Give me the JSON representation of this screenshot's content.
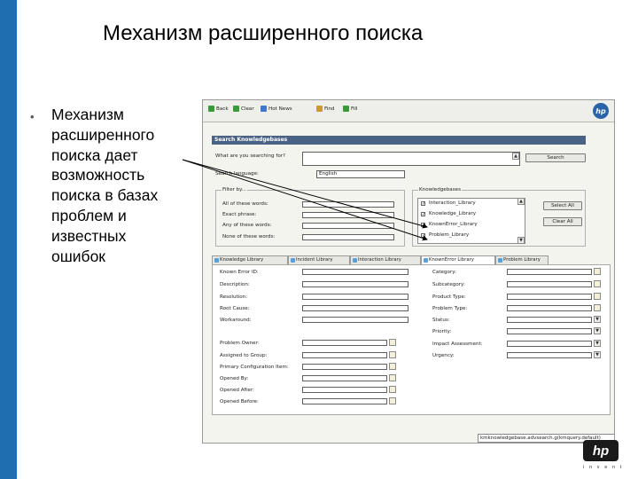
{
  "slide": {
    "title": "Механизм расширенного поиска",
    "bullet_lines": [
      "Механизм",
      "расширенного",
      "поиска дает",
      "возможность",
      "поиска в базах",
      "проблем и",
      "известных",
      "ошибок"
    ]
  },
  "toolbar": {
    "back": "Back",
    "clear": "Clear",
    "hot_news": "Hot News",
    "find": "Find",
    "fill": "Fill",
    "logo": "hp"
  },
  "search": {
    "header": "Search Knowledgebases",
    "what_label": "What are you searching for?",
    "lang_label": "Search language:",
    "lang_value": "English",
    "search_button": "Search"
  },
  "filter": {
    "title": "Filter by...",
    "rows": [
      "All of these words:",
      "Exact phrase:",
      "Any of these words:",
      "None of these words:"
    ]
  },
  "kb": {
    "title": "Knowledgebases",
    "items": [
      "Interaction_Library",
      "Knowledge_Library",
      "KnownError_Library",
      "Problem_Library"
    ],
    "select_all": "Select All",
    "clear_all": "Clear All"
  },
  "tabs": [
    "Knowledge Library",
    "Incident Library",
    "Interaction Library",
    "KnownError Library",
    "Problem Library"
  ],
  "known_error": {
    "left_top": [
      "Known Error ID:",
      "Description:",
      "Resolution:",
      "Root Cause:",
      "Workaround:"
    ],
    "left_bottom": [
      "Problem Owner:",
      "Assigned to Group:",
      "Primary Configuration Item:",
      "Opened By:",
      "Opened After:",
      "Opened Before:"
    ],
    "right": [
      "Category:",
      "Subcategory:",
      "Product Type:",
      "Problem Type:",
      "Status:",
      "Priority:",
      "Impact Assessment:",
      "Urgency:"
    ]
  },
  "statusbar": {
    "url": "kmknowledgebase.advsearch.g(kmquery.default)"
  },
  "footer": {
    "logo": "hp",
    "tagline": "invent"
  }
}
